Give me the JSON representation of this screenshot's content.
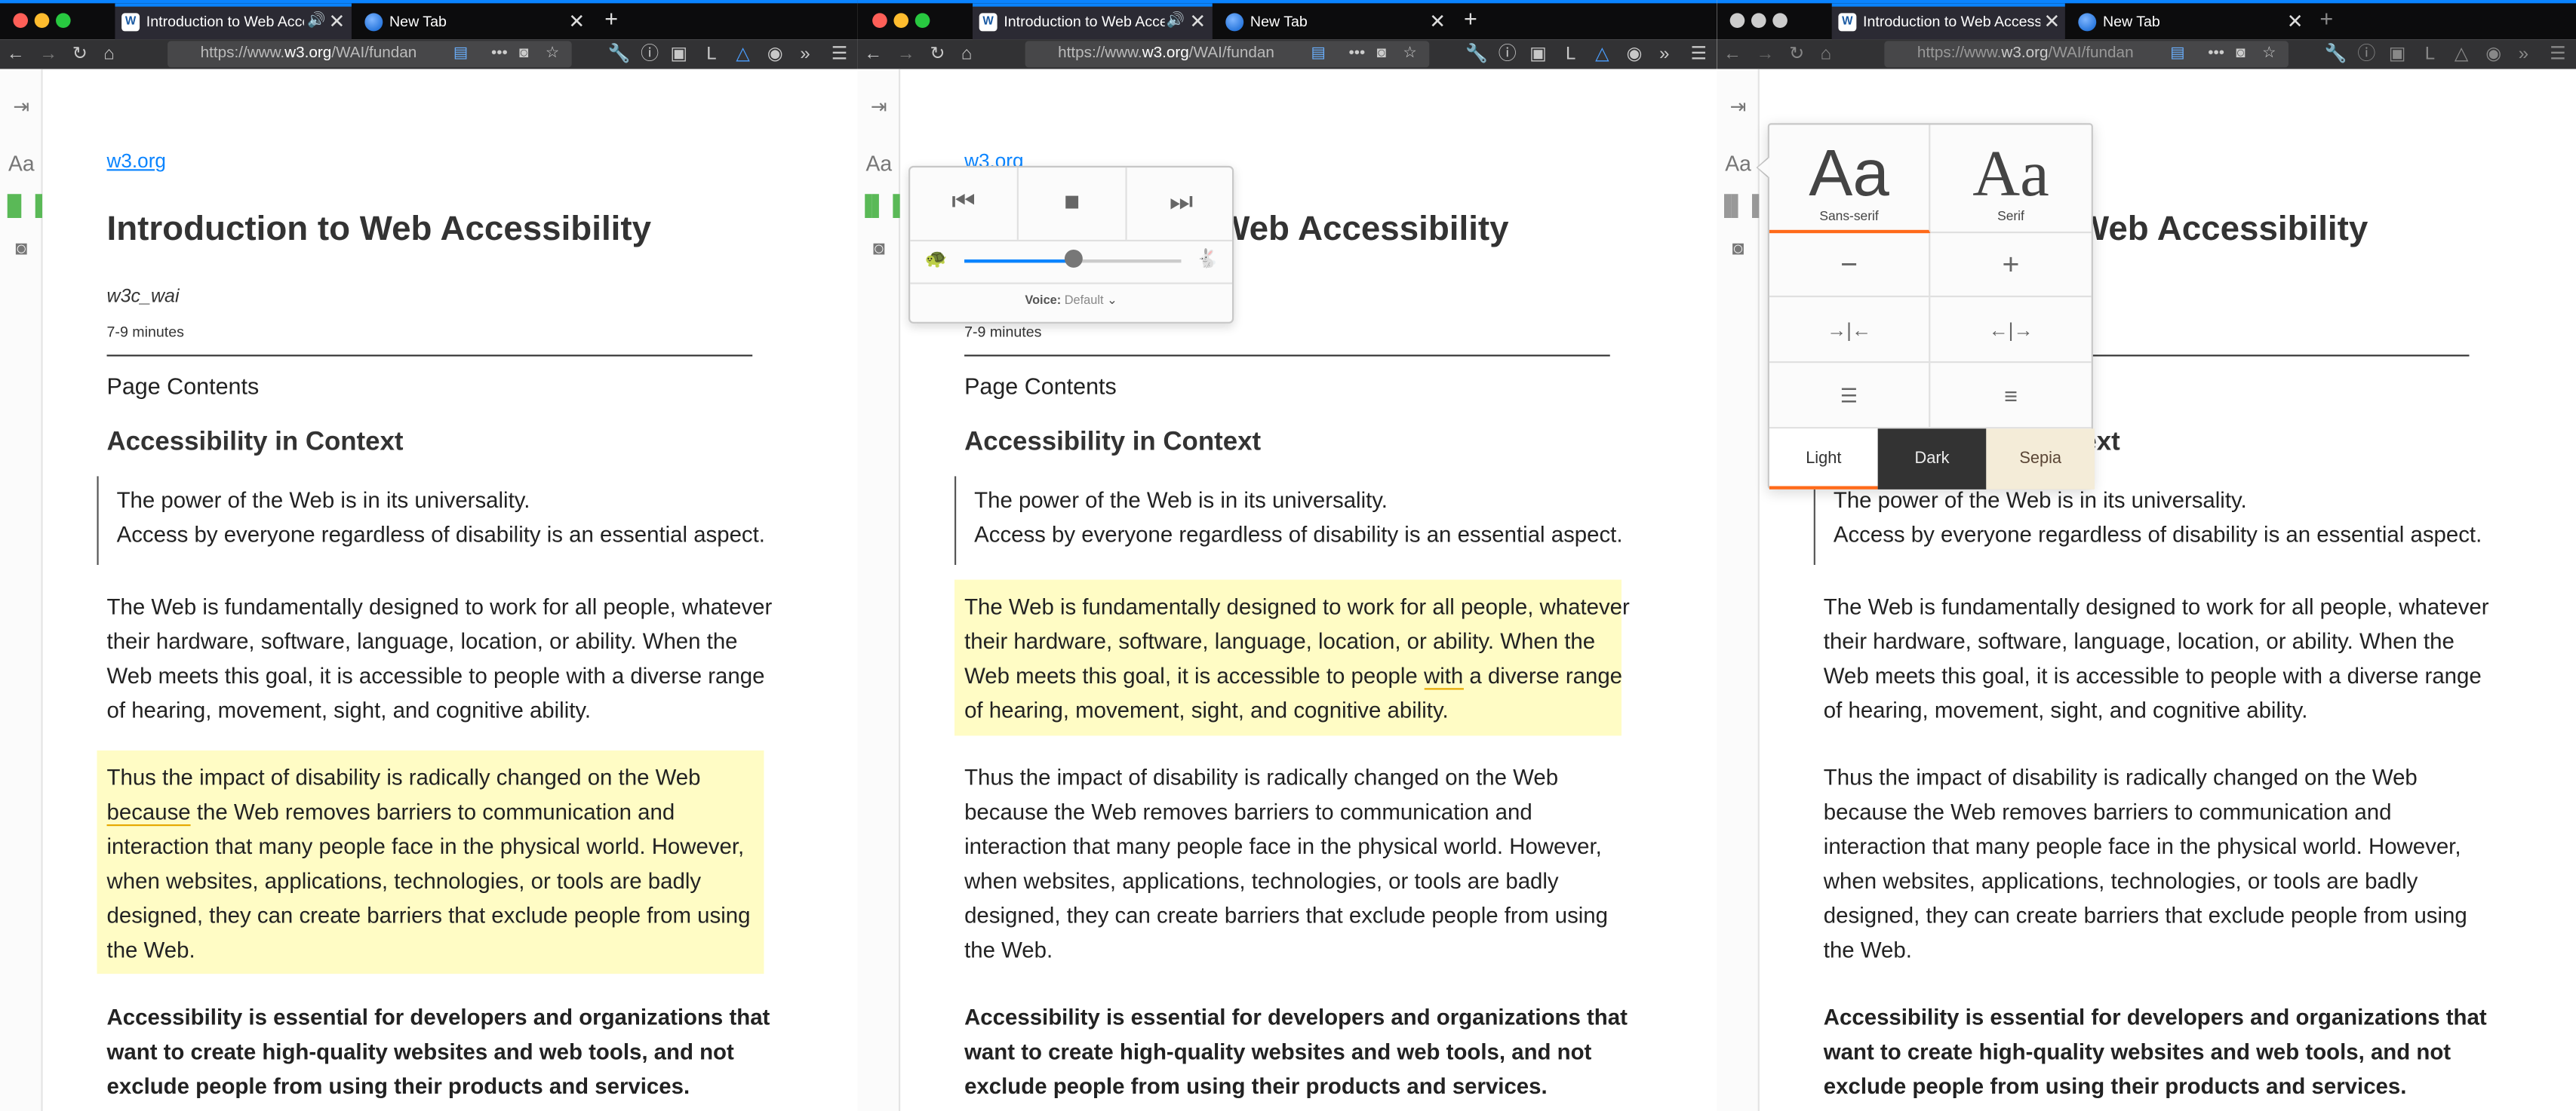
{
  "browser": {
    "tab_title": "Introduction to Web Access",
    "tab_title_full": "Introduction to Web Accessibili",
    "new_tab": "New Tab",
    "url": "https://www.w3.org/WAI/fundam",
    "url_prefix": "https://www.",
    "url_host": "w3.org",
    "url_path": "/WAI/fundan"
  },
  "article": {
    "domain": "w3.org",
    "title": "Introduction to Web Accessibility",
    "credits": "w3c_wai",
    "reading_time": "7-9 minutes",
    "page_contents": "Page Contents",
    "heading": "Accessibility in Context",
    "quote": [
      "The power of the Web is in its universality.",
      "Access by everyone regardless of disability is an essential aspect."
    ],
    "p1": [
      "The Web is fundamentally designed to work for all people, whatever",
      "their hardware, software, language, location, or ability. When the",
      "Web meets this goal, it is accessible to people with a diverse range",
      "of hearing, movement, sight, and cognitive ability."
    ],
    "p2": [
      "Thus the impact of disability is radically changed on the Web",
      "because the Web removes barriers to communication and",
      "interaction that many people face in the physical world. However,",
      "when websites, applications, technologies, or tools are badly",
      "designed, they can create barriers that exclude people from using",
      "the Web."
    ],
    "p3": [
      "Accessibility is essential for developers and organizations that",
      "want to create high-quality websites and web tools, and not",
      "exclude people from using their products and services."
    ]
  },
  "narrate": {
    "voice_label": "Voice:",
    "voice_value": "Default",
    "rate": 0.5
  },
  "typography": {
    "sans_label": "Sans-serif",
    "serif_label": "Serif",
    "glyph": "Aa",
    "themes": [
      "Light",
      "Dark",
      "Sepia"
    ],
    "colors": {
      "accent": "#ff6a1a",
      "dark": "#333333",
      "sepia": "#f4ecd8"
    }
  },
  "colors": {
    "highlight": "#fffcc5",
    "link": "#0a84ff"
  }
}
